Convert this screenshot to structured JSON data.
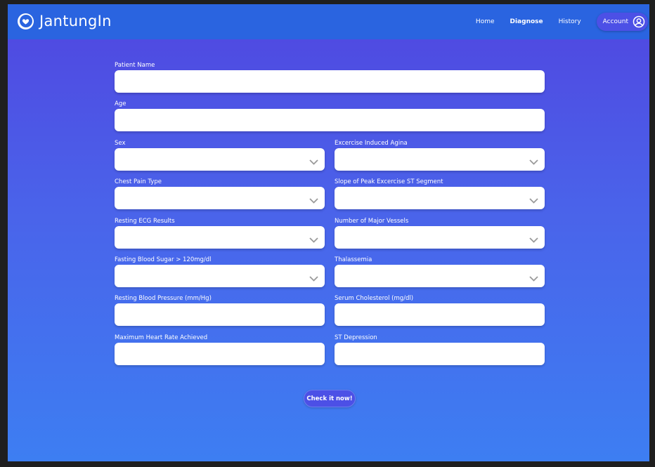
{
  "app": {
    "brand": "JantungIn",
    "logo_icon": "heart-icon"
  },
  "nav": {
    "links": [
      {
        "label": "Home",
        "active": false
      },
      {
        "label": "Diagnose",
        "active": true
      },
      {
        "label": "History",
        "active": false
      }
    ],
    "account_label": "Account",
    "account_icon": "user-circle-icon"
  },
  "form": {
    "patient_name": {
      "label": "Patient Name",
      "value": ""
    },
    "age": {
      "label": "Age",
      "value": ""
    },
    "sex": {
      "label": "Sex",
      "selected": ""
    },
    "exercise_induced_angina": {
      "label": "Excercise Induced Agina",
      "selected": ""
    },
    "chest_pain_type": {
      "label": "Chest Pain Type",
      "selected": ""
    },
    "slope_peak_st": {
      "label": "Slope of Peak Excercise ST Segment",
      "selected": ""
    },
    "resting_ecg": {
      "label": "Resting ECG Results",
      "selected": ""
    },
    "major_vessels": {
      "label": "Number of Major Vessels",
      "selected": ""
    },
    "fasting_blood_sugar": {
      "label": "Fasting Blood Sugar > 120mg/dl",
      "selected": ""
    },
    "thalassemia": {
      "label": "Thalassemia",
      "selected": ""
    },
    "resting_bp": {
      "label": "Resting Blood Pressure (mm/Hg)",
      "value": ""
    },
    "serum_cholesterol": {
      "label": "Serum Cholesterol (mg/dl)",
      "value": ""
    },
    "max_heart_rate": {
      "label": "Maximum Heart Rate Achieved",
      "value": ""
    },
    "st_depression": {
      "label": "ST Depression",
      "value": ""
    },
    "submit_label": "Check it now!"
  },
  "colors": {
    "navbar": "#2a64e0",
    "gradient_top": "#5046e0",
    "gradient_bottom": "#3d7ef2",
    "button": "#4c50e6"
  }
}
